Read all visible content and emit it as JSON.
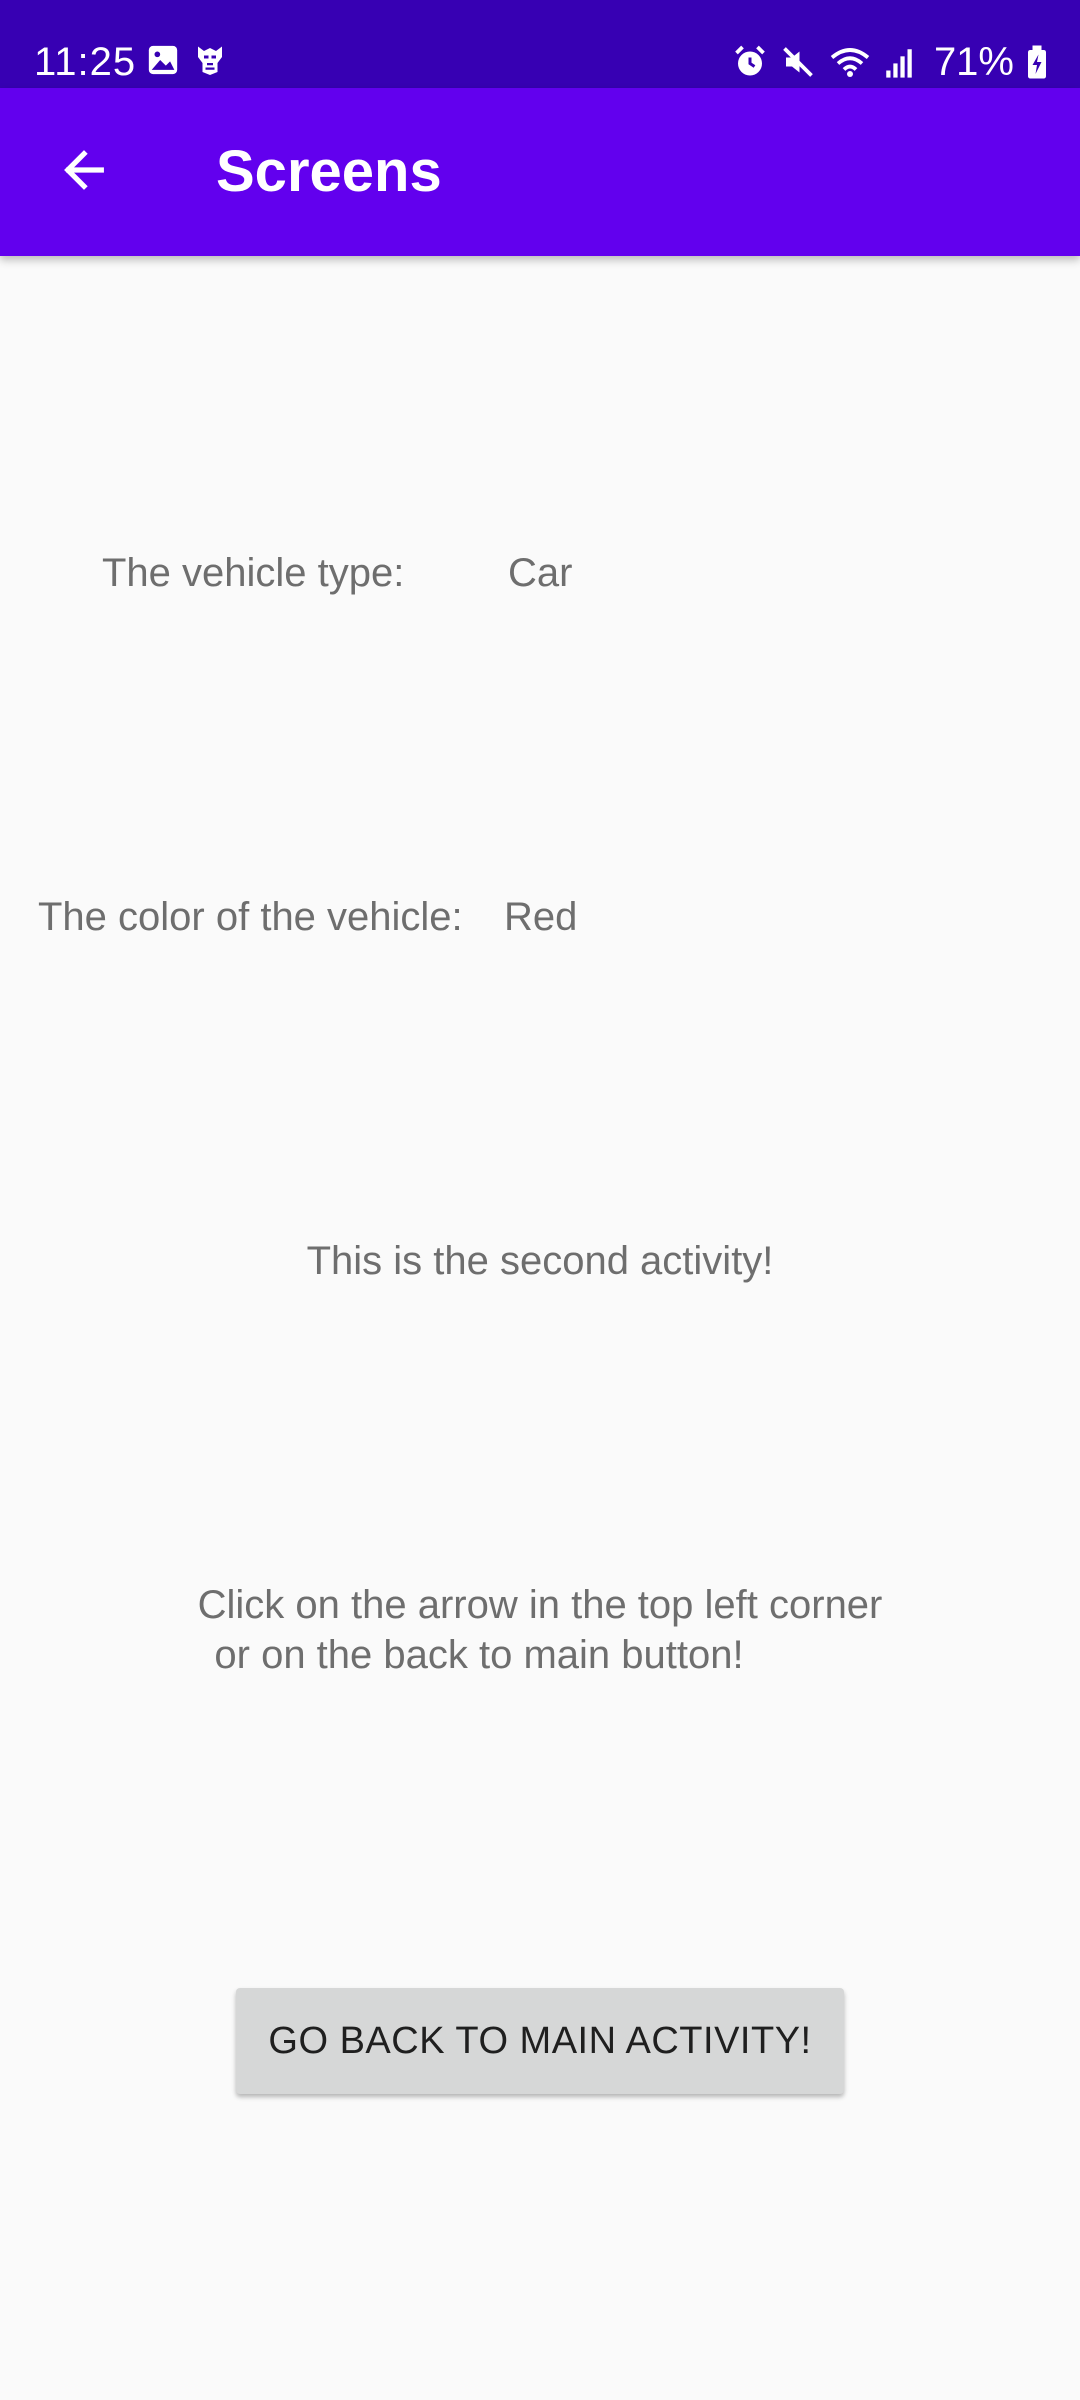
{
  "status_bar": {
    "time": "11:25",
    "battery": "71%",
    "left_icons": [
      "image-icon",
      "transformers-icon"
    ],
    "right_icons": [
      "alarm-icon",
      "mute-icon",
      "wifi-icon",
      "signal-icon",
      "battery-icon"
    ]
  },
  "app_bar": {
    "title": "Screens",
    "back_icon": "arrow-back-icon"
  },
  "content": {
    "vehicle_type_label": "The vehicle type:",
    "vehicle_type_value": "Car",
    "vehicle_color_label": "The color of the vehicle:",
    "vehicle_color_value": "Red",
    "second_activity_text": "This is the second activity!",
    "instruction_line1": "Click on the arrow in the top left corner",
    "instruction_line2": "or on the back to main button!"
  },
  "button": {
    "label": "GO BACK TO MAIN ACTIVITY!"
  },
  "colors": {
    "status_bar": "#3700b3",
    "app_bar": "#6200ee",
    "background": "#fafafa",
    "text": "#6e6e6e",
    "button_bg": "#d6d7d7"
  }
}
